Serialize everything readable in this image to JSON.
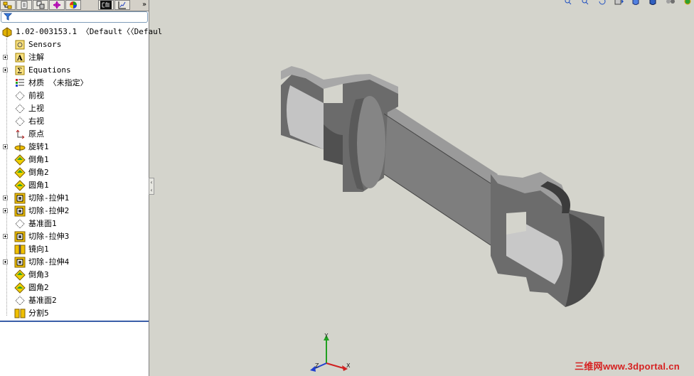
{
  "feature_tree": {
    "root": {
      "label": "1.02-003153.1  〈Default〈〈Defaul",
      "icon": "part-icon"
    },
    "items": [
      {
        "label": "Sensors",
        "icon": "sensors-icon",
        "expandable": false
      },
      {
        "label": "注解",
        "icon": "annotations-icon",
        "expandable": true
      },
      {
        "label": "Equations",
        "icon": "equations-icon",
        "expandable": true
      },
      {
        "label": "材质 〈未指定〉",
        "icon": "material-icon",
        "expandable": false
      },
      {
        "label": "前视",
        "icon": "plane-icon",
        "expandable": false
      },
      {
        "label": "上视",
        "icon": "plane-icon",
        "expandable": false
      },
      {
        "label": "右视",
        "icon": "plane-icon",
        "expandable": false
      },
      {
        "label": "原点",
        "icon": "origin-icon",
        "expandable": false
      },
      {
        "label": "旋转1",
        "icon": "revolve-icon",
        "expandable": true
      },
      {
        "label": "倒角1",
        "icon": "chamfer-icon",
        "expandable": false
      },
      {
        "label": "倒角2",
        "icon": "chamfer-icon",
        "expandable": false
      },
      {
        "label": "圆角1",
        "icon": "fillet-icon",
        "expandable": false
      },
      {
        "label": "切除-拉伸1",
        "icon": "cut-extrude-icon",
        "expandable": true
      },
      {
        "label": "切除-拉伸2",
        "icon": "cut-extrude-icon",
        "expandable": true
      },
      {
        "label": "基准面1",
        "icon": "plane-icon",
        "expandable": false
      },
      {
        "label": "切除-拉伸3",
        "icon": "cut-extrude-icon",
        "expandable": true
      },
      {
        "label": "镜向1",
        "icon": "mirror-icon",
        "expandable": false
      },
      {
        "label": "切除-拉伸4",
        "icon": "cut-extrude-icon",
        "expandable": true
      },
      {
        "label": "倒角3",
        "icon": "chamfer-icon",
        "expandable": false
      },
      {
        "label": "圆角2",
        "icon": "fillet-icon",
        "expandable": false
      },
      {
        "label": "基准面2",
        "icon": "plane-icon",
        "expandable": false
      },
      {
        "label": "分割5",
        "icon": "split-icon",
        "expandable": false
      }
    ]
  },
  "panel_tabs": [
    {
      "name": "feature-manager-tab",
      "icon": "feature-tree-icon"
    },
    {
      "name": "property-manager-tab",
      "icon": "property-icon"
    },
    {
      "name": "configuration-manager-tab",
      "icon": "configuration-icon"
    },
    {
      "name": "dimxpert-tab",
      "icon": "dimxpert-icon"
    },
    {
      "name": "display-manager-tab",
      "icon": "appearance-icon"
    },
    {
      "name": "cam-tab",
      "icon": "cam-icon"
    },
    {
      "name": "simulation-tab",
      "icon": "chart-icon"
    }
  ],
  "triad": {
    "x": "X",
    "y": "Y",
    "z": "Z"
  },
  "watermark": "三维网www.3dportal.cn",
  "colors": {
    "viewport_bg": "#d4d4cc",
    "part_gray": "#7a7a7a",
    "accent_blue": "#3a5ea8",
    "watermark_red": "#d62020"
  }
}
